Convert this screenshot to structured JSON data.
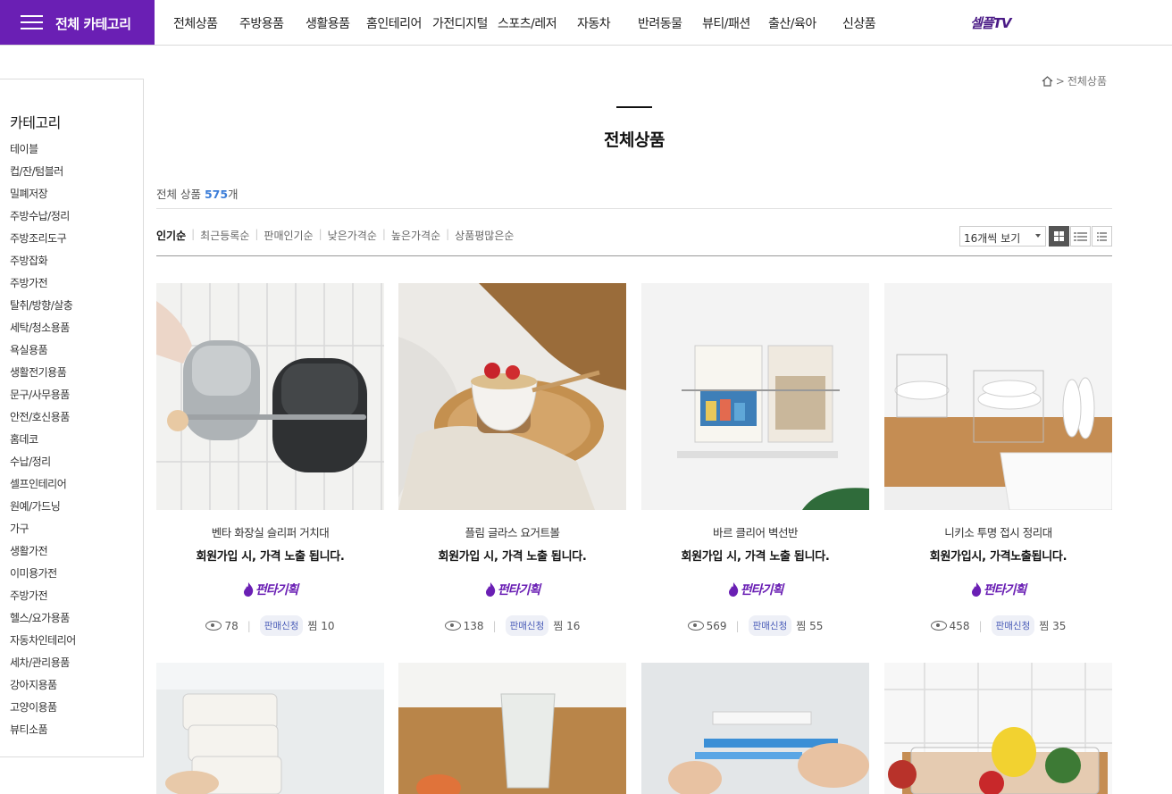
{
  "header": {
    "category_button": "전체 카테고리",
    "menu": [
      "전체상품",
      "주방용품",
      "생활용품",
      "홈인테리어",
      "가전디지털",
      "스포츠/레저",
      "자동차",
      "반려동물",
      "뷰티/패션",
      "출산/육아",
      "신상품"
    ],
    "logo": "셀플TV"
  },
  "sidebar": {
    "title": "카테고리",
    "items": [
      "테이블",
      "컵/잔/텀블러",
      "밀폐저장",
      "주방수납/정리",
      "주방조리도구",
      "주방잡화",
      "주방가전",
      "탈취/방향/살충",
      "세탁/청소용품",
      "욕실용품",
      "생활전기용품",
      "문구/사무용품",
      "안전/호신용품",
      "홈데코",
      "수납/정리",
      "셀프인테리어",
      "원예/가드닝",
      "가구",
      "생활가전",
      "이미용가전",
      "주방가전",
      "헬스/요가용품",
      "자동차인테리어",
      "세차/관리용품",
      "강아지용품",
      "고양이용품",
      "뷰티소품"
    ]
  },
  "breadcrumb": {
    "current": "전체상품",
    "sep": ">"
  },
  "page_title": "전체상품",
  "count": {
    "prefix": "전체 상품 ",
    "value": "575",
    "suffix": "개"
  },
  "sorts": [
    "인기순",
    "최근등록순",
    "판매인기순",
    "낮은가격순",
    "높은가격순",
    "상품평많은순"
  ],
  "per_page": "16개씩 보기",
  "colors": {
    "brand": "#6a1fb4",
    "count": "#3b7dd8"
  },
  "products": [
    {
      "name": "벤타 화장실 슬리퍼 거치대",
      "price": "회원가입 시, 가격 노출 됩니다.",
      "badge": "펀타기획",
      "views": "78",
      "sell": "판매신청",
      "likes": "찜 10"
    },
    {
      "name": "플림 글라스 요거트볼",
      "price": "회원가입 시, 가격 노출 됩니다.",
      "badge": "펀타기획",
      "views": "138",
      "sell": "판매신청",
      "likes": "찜 16"
    },
    {
      "name": "바르 클리어 벽선반",
      "price": "회원가입 시, 가격 노출 됩니다.",
      "badge": "펀타기획",
      "views": "569",
      "sell": "판매신청",
      "likes": "찜 55"
    },
    {
      "name": "니키소 투명 접시 정리대",
      "price": "회원가입시, 가격노출됩니다.",
      "badge": "펀타기획",
      "views": "458",
      "sell": "판매신청",
      "likes": "찜 35"
    }
  ]
}
